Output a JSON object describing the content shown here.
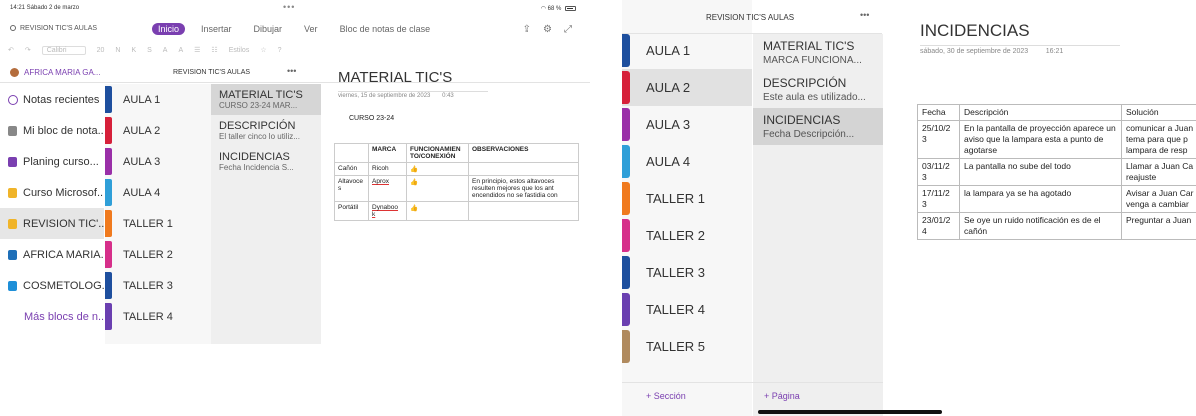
{
  "left": {
    "status": {
      "time": "14:21  Sábado 2 de marzo",
      "dots": "•••",
      "battery": "68 %"
    },
    "search_label": "REVISION TIC'S AULAS",
    "tabs": [
      "Inicio",
      "Insertar",
      "Dibujar",
      "Ver",
      "Bloc de notas de clase"
    ],
    "toolbar": {
      "font": "Calibri",
      "size": "20",
      "items": [
        "N",
        "K",
        "S",
        "A",
        "A",
        "Estilos"
      ]
    },
    "user": "AFRICA MARIA GA...",
    "notebook_title": "REVISION TIC'S AULAS",
    "more_dots": "•••",
    "notebooks": [
      {
        "label": "Notas recientes",
        "color": "#7a3fb0",
        "icon": "clock-icon"
      },
      {
        "label": "Mi bloc de nota...",
        "color": "#888888",
        "icon": "notebook-icon"
      },
      {
        "label": "Planing curso...",
        "color": "#7a3fb0",
        "icon": "notebook-icon"
      },
      {
        "label": "Curso Microsof...",
        "color": "#f0b429",
        "icon": "notebook-icon"
      },
      {
        "label": "REVISION TIC'...",
        "color": "#f0b429",
        "icon": "notebook-icon"
      },
      {
        "label": "AFRICA MARIA...",
        "color": "#1e6fb8",
        "icon": "notebook-icon"
      },
      {
        "label": "COSMETOLOG...",
        "color": "#1e8fd8",
        "icon": "notebook-icon"
      }
    ],
    "more_notebooks": "Más blocs de n...",
    "sections": [
      {
        "label": "AULA 1",
        "color": "#1e4f9e"
      },
      {
        "label": "AULA 2",
        "color": "#d6203a"
      },
      {
        "label": "AULA 3",
        "color": "#9a2fa8"
      },
      {
        "label": "AULA 4",
        "color": "#2f9fd8"
      },
      {
        "label": "TALLER 1",
        "color": "#f07a1e"
      },
      {
        "label": "TALLER 2",
        "color": "#d62f8a"
      },
      {
        "label": "TALLER 3",
        "color": "#1e4f9e"
      },
      {
        "label": "TALLER 4",
        "color": "#6a3fb0"
      }
    ],
    "pages": [
      {
        "title": "MATERIAL TIC'S",
        "sub": "CURSO 23-24  MAR..."
      },
      {
        "title": "DESCRIPCIÓN",
        "sub": "El taller cinco lo utiliz..."
      },
      {
        "title": "INCIDENCIAS",
        "sub": "Fecha  Incidencia  S..."
      }
    ],
    "page": {
      "title": "MATERIAL TIC'S",
      "date": "viernes, 15 de septiembre de 2023",
      "time": "0:43",
      "curso": "CURSO 23-24",
      "table": {
        "headers": [
          "",
          "MARCA",
          "FUNCIONAMIEN TO/CONEXIÓN",
          "OBSERVACIONES"
        ],
        "rows": [
          [
            "Cañón",
            "Ricoh",
            "👍",
            ""
          ],
          [
            "Altavoce s",
            "Aprox",
            "👍",
            "En principio, estos altavoces resulten mejores que los ant encendidos no se fastidia con"
          ],
          [
            "Portátil",
            "Dynaboo k",
            "👍",
            ""
          ]
        ]
      }
    }
  },
  "right": {
    "notebook_title": "REVISION TIC'S AULAS",
    "more_dots": "•••",
    "sections": [
      {
        "label": "AULA 1",
        "color": "#1e4f9e"
      },
      {
        "label": "AULA 2",
        "color": "#d6203a"
      },
      {
        "label": "AULA 3",
        "color": "#9a2fa8"
      },
      {
        "label": "AULA 4",
        "color": "#2f9fd8"
      },
      {
        "label": "TALLER 1",
        "color": "#f07a1e"
      },
      {
        "label": "TALLER 2",
        "color": "#d62f8a"
      },
      {
        "label": "TALLER 3",
        "color": "#1e4f9e"
      },
      {
        "label": "TALLER 4",
        "color": "#6a3fb0"
      },
      {
        "label": "TALLER 5",
        "color": "#b08a5e"
      }
    ],
    "pages": [
      {
        "title": "MATERIAL TIC'S",
        "sub": "MARCA  FUNCIONA..."
      },
      {
        "title": "DESCRIPCIÓN",
        "sub": "Este aula es utilizado..."
      },
      {
        "title": "INCIDENCIAS",
        "sub": "Fecha  Descripción..."
      }
    ],
    "add_section": "+ Sección",
    "add_page": "+ Página",
    "page": {
      "title": "INCIDENCIAS",
      "date": "sábado, 30 de septiembre de 2023",
      "time": "16:21",
      "table": {
        "headers": [
          "Fecha",
          "Descripción",
          "Solución"
        ],
        "rows": [
          [
            "25/10/2 3",
            "En la pantalla de proyección aparece un aviso que la lampara esta a punto de agotarse",
            "comunicar a Juan tema para que p lampara de resp"
          ],
          [
            "03/11/2 3",
            "La pantalla no sube del todo",
            "Llamar a Juan Ca la reajuste"
          ],
          [
            "17/11/2 3",
            "la lampara ya se ha agotado",
            "Avisar a Juan Car venga a cambiar"
          ],
          [
            "23/01/2 4",
            "Se oye un ruido notificación es de el cañón",
            "Preguntar a Juan"
          ]
        ]
      }
    }
  }
}
